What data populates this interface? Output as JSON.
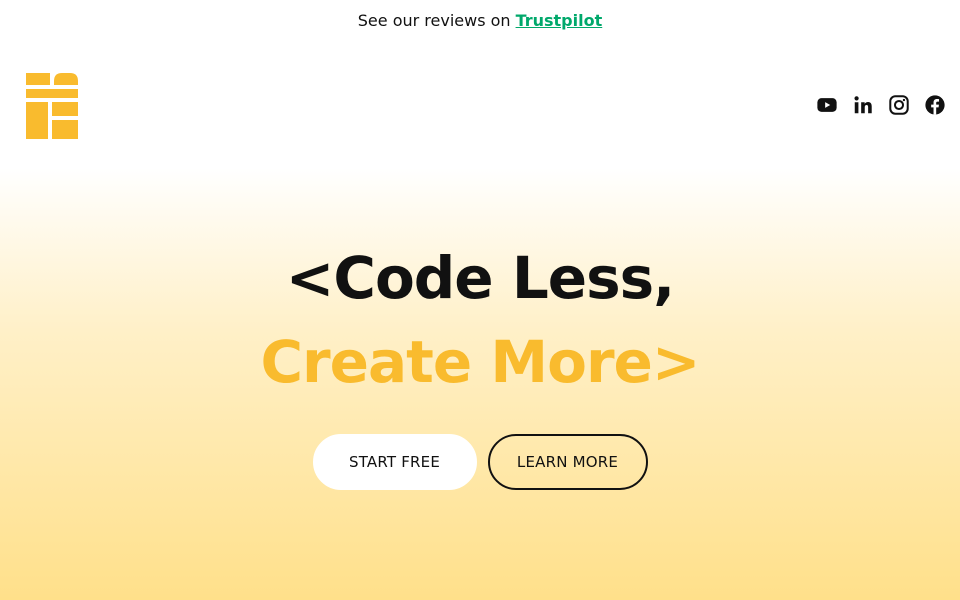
{
  "topbar": {
    "prefix": "See our reviews on",
    "link_label": "Trustpilot",
    "link_color": "#00a86b"
  },
  "logo": {
    "icon": "stacked-blocks-logo",
    "color": "#f9bb2e"
  },
  "socials": [
    {
      "icon": "youtube-icon"
    },
    {
      "icon": "linkedin-icon"
    },
    {
      "icon": "instagram-icon"
    },
    {
      "icon": "facebook-icon"
    }
  ],
  "hero": {
    "line1_prefix": "<",
    "line1_text": "Code Less,",
    "line2_text": "Create More",
    "line2_suffix": ">",
    "accent_color": "#f9bb2e"
  },
  "buttons": {
    "start_label": "START FREE",
    "learn_label": "LEARN MORE"
  }
}
